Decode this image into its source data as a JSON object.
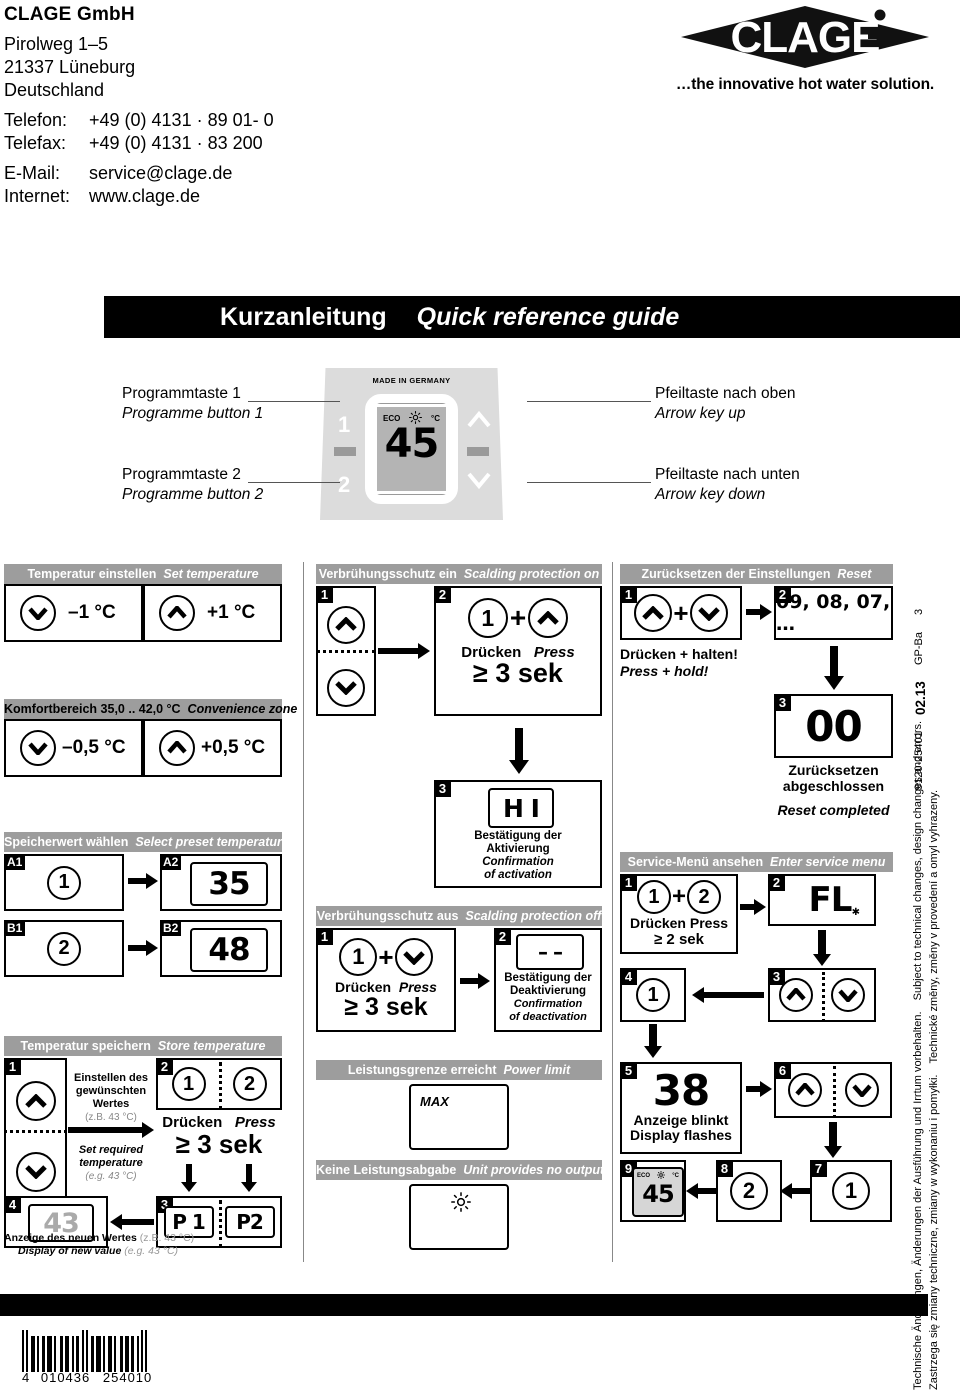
{
  "company": {
    "name": "CLAGE GmbH",
    "street": "Pirolweg 1–5",
    "city": "21337 Lüneburg",
    "country": "Deutschland",
    "phone_label": "Telefon:",
    "phone_value": "+49 (0) 4131 · 89 01- 0",
    "fax_label": "Telefax:",
    "fax_value": "+49 (0) 4131 · 83 200",
    "email_label": "E-Mail:",
    "email_value": "service@clage.de",
    "web_label": "Internet:",
    "web_value": "www.clage.de"
  },
  "logo": {
    "wordmark": "CLAGE",
    "slogan": "…the innovative hot water solution."
  },
  "title": {
    "de": "Kurzanleitung",
    "en": "Quick reference guide"
  },
  "device": {
    "made_in": "MADE IN GERMANY",
    "display": {
      "eco": "ECO",
      "sun": "sun-icon",
      "unit": "°C",
      "value": "45"
    },
    "btn1": "1",
    "btn2": "2",
    "callouts": {
      "prog1_de": "Programmtaste 1",
      "prog1_en": "Programme button 1",
      "prog2_de": "Programmtaste 2",
      "prog2_en": "Programme button 2",
      "up_de": "Pfeiltaste nach oben",
      "up_en": "Arrow key up",
      "down_de": "Pfeiltaste nach unten",
      "down_en": "Arrow key down"
    }
  },
  "sections": {
    "set_temp": {
      "de": "Temperatur einstellen",
      "en": "Set temperature",
      "minus": "–1 °C",
      "plus": "+1 °C"
    },
    "convenience": {
      "de": "Komfortbereich 35,0 .. 42,0 °C",
      "en": "Convenience zone",
      "minus": "–0,5 °C",
      "plus": "+0,5 °C"
    },
    "preset": {
      "de": "Speicherwert wählen",
      "en": "Select preset temperature",
      "a1": "A1",
      "a1_btn": "1",
      "a2": "A2",
      "a2_val": "35",
      "b1": "B1",
      "b1_btn": "2",
      "b2": "B2",
      "b2_val": "48"
    },
    "store": {
      "de": "Temperatur speichern",
      "en": "Store temperature",
      "s1": "1",
      "s2": "2",
      "s3": "3",
      "s4": "4",
      "note_de1": "Einstellen des",
      "note_de2": "gewünschten",
      "note_de3": "Wertes",
      "note_de4": "(z.B. 43 °C)",
      "note_en1": "Set required",
      "note_en2": "temperature",
      "note_en3": "(e.g. 43 °C)",
      "btn1": "1",
      "btn2": "2",
      "press_de": "Drücken",
      "press_en": "Press",
      "press_time": "≥ 3 sek",
      "p1": "P 1",
      "p2": "P2",
      "new_val": "43",
      "foot_de": "Anzeige des neuen Wertes",
      "foot_de_paren": "(z.B. 43 °C)",
      "foot_en": "Display of new value",
      "foot_en_paren": "(e.g. 43 °C)"
    },
    "scald_on": {
      "de": "Verbrühungsschutz ein",
      "en": "Scalding protection on",
      "s1": "1",
      "s2": "2",
      "s3": "3",
      "btn1": "1",
      "plus": "+",
      "press_de": "Drücken",
      "press_en": "Press",
      "press_time": "≥ 3 sek",
      "code": "H I",
      "conf_de1": "Bestätigung der",
      "conf_de2": "Aktivierung",
      "conf_en1": "Confirmation",
      "conf_en2": "of activation"
    },
    "scald_off": {
      "de": "Verbrühungsschutz aus",
      "en": "Scalding protection off",
      "s1": "1",
      "s2": "2",
      "btn1": "1",
      "plus": "+",
      "press_de": "Drücken",
      "press_en": "Press",
      "press_time": "≥ 3 sek",
      "code": "– –",
      "conf_de1": "Bestätigung der",
      "conf_de2": "Deaktivierung",
      "conf_en1": "Confirmation",
      "conf_en2": "of deactivation"
    },
    "power_limit": {
      "de": "Leistungsgrenze erreicht",
      "en": "Power limit",
      "code": "MAX"
    },
    "no_output": {
      "de": "Keine Leistungsabgabe",
      "en": "Unit provides no output",
      "code": "sun-icon"
    },
    "reset": {
      "de": "Zurücksetzen der Einstellungen",
      "en": "Reset",
      "s1": "1",
      "s2": "2",
      "s3": "3",
      "plus": "+",
      "hold_de": "Drücken + halten!",
      "hold_en": "Press + hold!",
      "countdown": "09, 08, 07, …",
      "done_code": "00",
      "done_de1": "Zurücksetzen",
      "done_de2": "abgeschlossen",
      "done_en": "Reset completed"
    },
    "service": {
      "de": "Service-Menü ansehen",
      "en": "Enter service menu",
      "s1": "1",
      "s2": "2",
      "s3": "3",
      "s4": "4",
      "s5": "5",
      "s6": "6",
      "s7": "7",
      "s8": "8",
      "s9": "9",
      "btn1": "1",
      "btn2": "2",
      "plus": "+",
      "press_de": "Drücken",
      "press_en": "Press",
      "press_time": "≥ 2 sek",
      "code_fl": "FL",
      "val_38": "38",
      "flash_de": "Anzeige blinkt",
      "flash_en": "Display flashes",
      "step4_btn": "1",
      "step7_btn": "1",
      "step8_btn": "2",
      "final": {
        "eco": "ECO",
        "unit": "°C",
        "value": "45"
      }
    }
  },
  "legal": {
    "de": "Technische Änderungen, Änderungen der Ausführung und Irrtum vorbehalten.",
    "en": "Subject to technical changes, design changes and errors.",
    "pl1": "Technické změny, změny v provedení a omyl vyhrazeny.",
    "pl2": "Zastrzega się zmiany techniczne, zmiany w wykonaniu i pomyłki.",
    "docnum": "9120-25401",
    "date": "02.13",
    "code": "GP-Ba",
    "page": "3"
  },
  "barcode": {
    "lead": "4",
    "group1": "010436",
    "group2": "254010"
  }
}
